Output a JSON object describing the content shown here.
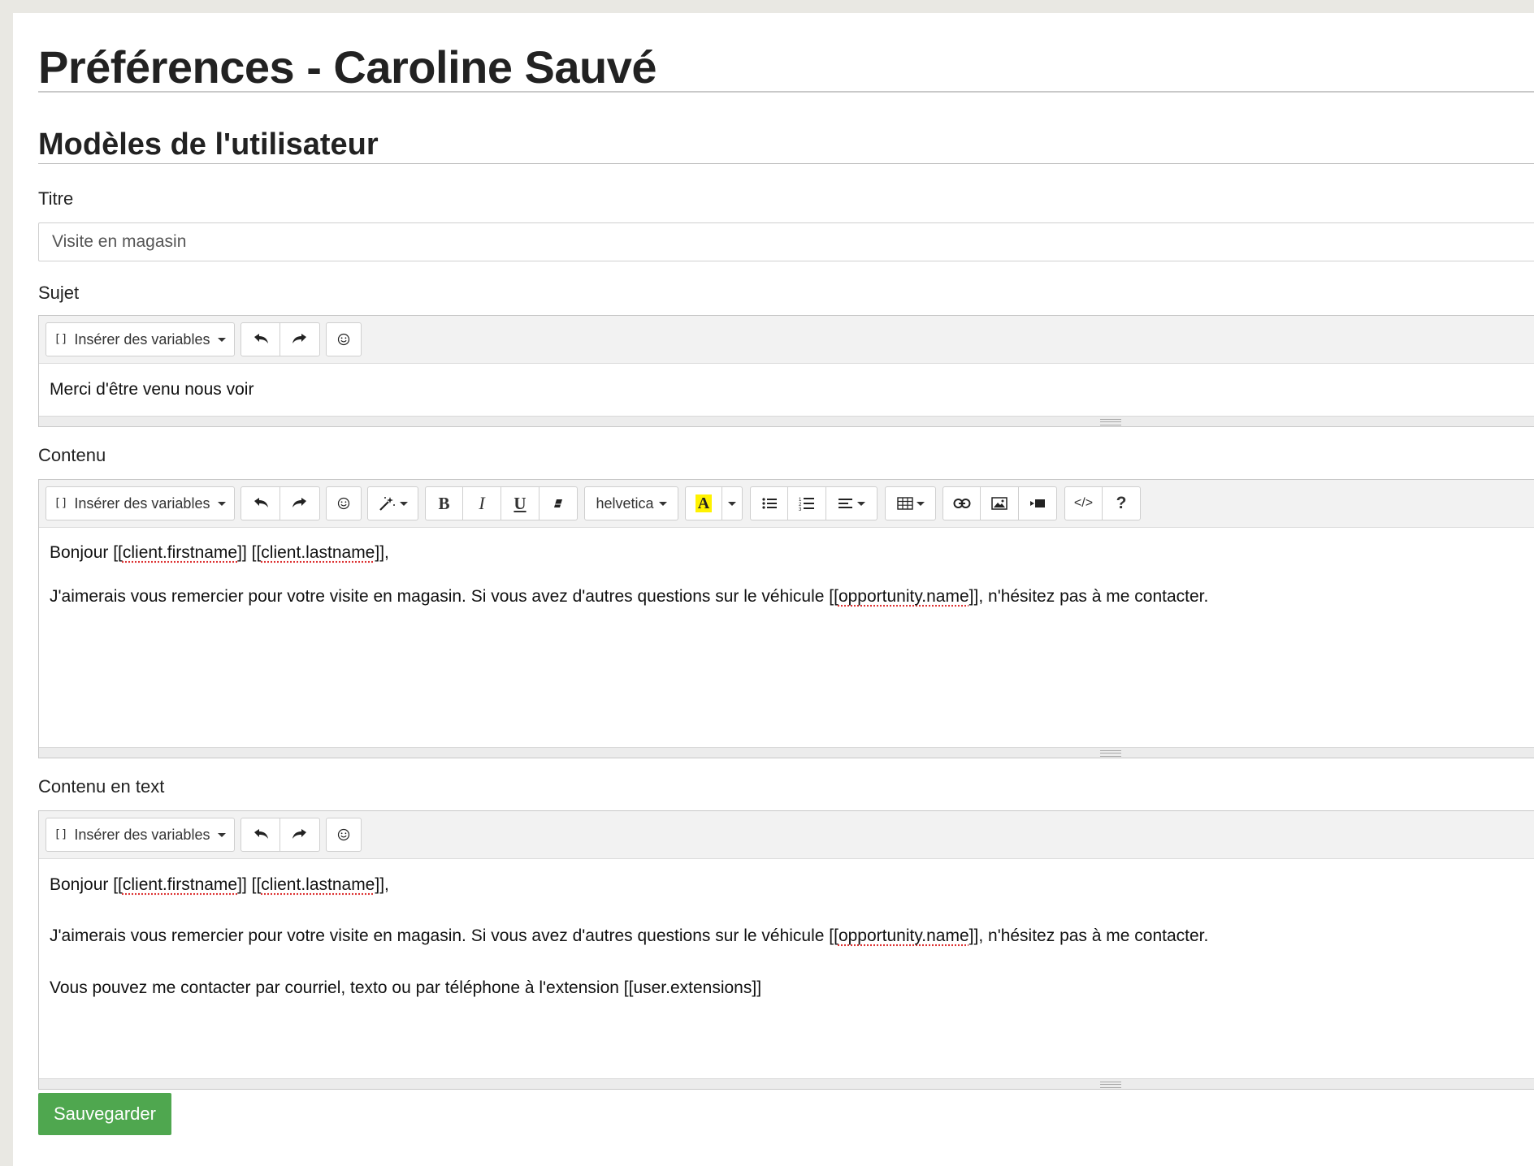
{
  "page": {
    "title": "Préférences - Caroline Sauvé",
    "section_title": "Modèles de l'utilisateur"
  },
  "titre": {
    "label": "Titre",
    "value": "Visite en magasin"
  },
  "sujet": {
    "label": "Sujet",
    "toolbar": {
      "insert_variables": "Insérer des variables",
      "icons": [
        "undo-icon",
        "redo-icon",
        "emoji-icon"
      ]
    },
    "text": "Merci d'être venu nous voir"
  },
  "contenu": {
    "label": "Contenu",
    "toolbar": {
      "insert_variables": "Insérer des variables",
      "font_name": "helvetica",
      "bold_label": "B",
      "italic_label": "I",
      "underline_label": "U",
      "color_label": "A",
      "help_label": "?",
      "code_label": "</>"
    },
    "line1": {
      "prefix": "Bonjour [[",
      "var1": "client.firstname",
      "mid": "]] [[",
      "var2": "client.lastname",
      "suffix": "]],"
    },
    "line2": {
      "prefix": "J'aimerais vous remercier pour votre visite en magasin. Si vous avez d'autres questions sur le véhicule [[",
      "var": "opportunity.name",
      "suffix": "]], n'hésitez pas à me contacter."
    }
  },
  "contenu_text": {
    "label": "Contenu en text",
    "toolbar": {
      "insert_variables": "Insérer des variables"
    },
    "line1": {
      "prefix": "Bonjour [[",
      "var1": "client.firstname",
      "mid": "]] [[",
      "var2": "client.lastname",
      "suffix": "]],"
    },
    "line2": {
      "prefix": "J'aimerais vous remercier pour votre visite en magasin. Si vous avez d'autres questions sur le véhicule [[",
      "var": "opportunity.name",
      "suffix": "]], n'hésitez pas à me contacter."
    },
    "line3": "Vous pouvez me contacter par courriel, texto ou par téléphone à l'extension [[user.extensions]]"
  },
  "actions": {
    "save_label": "Sauvegarder",
    "save_color": "#4fa74f"
  }
}
